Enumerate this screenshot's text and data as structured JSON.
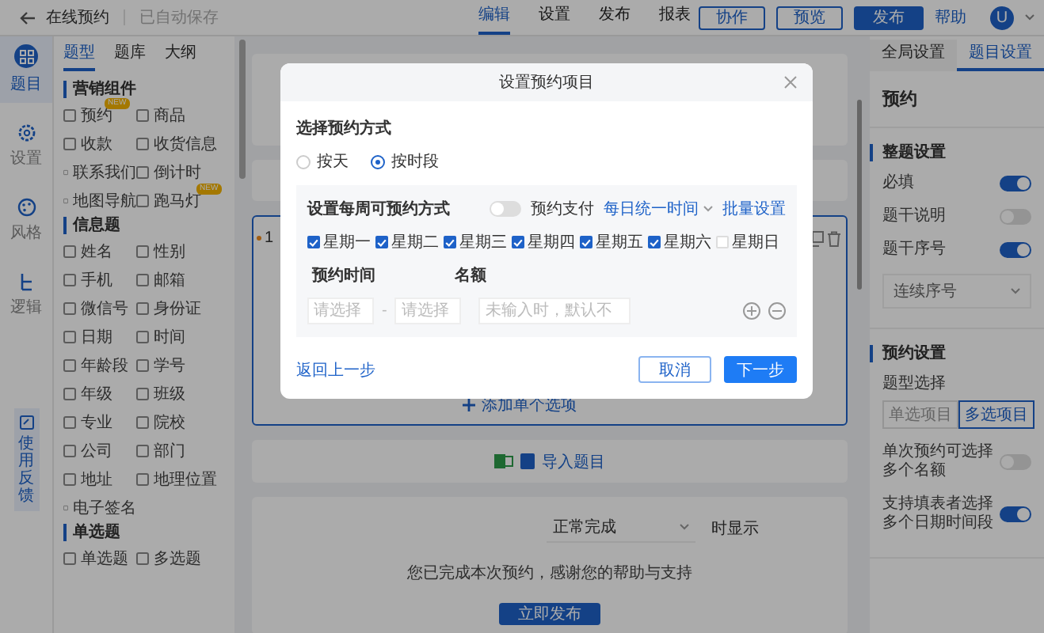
{
  "topbar": {
    "title": "在线预约",
    "save_status": "已自动保存",
    "tabs": [
      {
        "label": "编辑",
        "selected": true
      },
      {
        "label": "设置",
        "selected": false
      },
      {
        "label": "发布",
        "selected": false
      },
      {
        "label": "报表",
        "selected": false
      }
    ],
    "buttons": [
      {
        "label": "协作",
        "kind": "outline"
      },
      {
        "label": "预览",
        "kind": "outline"
      },
      {
        "label": "发布",
        "kind": "primary"
      },
      {
        "label": "帮助",
        "kind": "link"
      }
    ],
    "avatar": "U"
  },
  "rail": [
    {
      "label": "题目",
      "selected": true,
      "kind": "grid"
    },
    {
      "label": "设置",
      "selected": false,
      "kind": "gear"
    },
    {
      "label": "风格",
      "selected": false,
      "kind": "palette"
    },
    {
      "label": "逻辑",
      "selected": false,
      "kind": "flow"
    }
  ],
  "feedback": "使用反馈",
  "palette": {
    "tabs": [
      {
        "label": "题型",
        "selected": true
      },
      {
        "label": "题库",
        "selected": false
      },
      {
        "label": "大纲",
        "selected": false
      }
    ],
    "sections": [
      {
        "title": "营销组件",
        "items": [
          {
            "label": "预约",
            "badge": "NEW"
          },
          {
            "label": "商品"
          },
          {
            "label": "收款"
          },
          {
            "label": "收货信息"
          },
          {
            "label": "联系我们"
          },
          {
            "label": "倒计时"
          },
          {
            "label": "地图导航"
          },
          {
            "label": "跑马灯",
            "badge": "NEW"
          }
        ]
      },
      {
        "title": "信息题",
        "items": [
          {
            "label": "姓名"
          },
          {
            "label": "性别"
          },
          {
            "label": "手机"
          },
          {
            "label": "邮箱"
          },
          {
            "label": "微信号"
          },
          {
            "label": "身份证"
          },
          {
            "label": "日期"
          },
          {
            "label": "时间"
          },
          {
            "label": "年龄段"
          },
          {
            "label": "学号"
          },
          {
            "label": "年级"
          },
          {
            "label": "班级"
          },
          {
            "label": "专业"
          },
          {
            "label": "院校"
          },
          {
            "label": "公司"
          },
          {
            "label": "部门"
          },
          {
            "label": "地址"
          },
          {
            "label": "地理位置"
          },
          {
            "label": "电子签名"
          }
        ]
      },
      {
        "title": "单选题",
        "items": [
          {
            "label": "单选题"
          },
          {
            "label": "多选题"
          }
        ]
      }
    ]
  },
  "canvas": {
    "question_number": "1",
    "add_option": "添加单个选项",
    "import": "导入题目",
    "end": {
      "dropdown": "正常完成",
      "suffix": "时显示",
      "message": "您已完成本次预约，感谢您的帮助与支持",
      "publish": "立即发布"
    }
  },
  "settings": {
    "tabs": [
      {
        "label": "全局设置",
        "selected": false
      },
      {
        "label": "题目设置",
        "selected": true
      }
    ],
    "title": "预约",
    "sections": [
      {
        "title": "整题设置",
        "rows": [
          {
            "kind": "toggle",
            "label": "必填",
            "on": true
          },
          {
            "kind": "toggle",
            "label": "题干说明",
            "on": false
          },
          {
            "kind": "toggle",
            "label": "题干序号",
            "on": true
          },
          {
            "kind": "select",
            "value": "连续序号"
          }
        ]
      },
      {
        "title": "预约设置",
        "rows": [
          {
            "kind": "segmented",
            "label": "题型选择",
            "options": [
              {
                "label": "单选项目",
                "selected": false
              },
              {
                "label": "多选项目",
                "selected": true
              }
            ]
          },
          {
            "kind": "toggle",
            "label": "单次预约可选择多个名额",
            "on": false
          },
          {
            "kind": "toggle",
            "label": "支持填表者选择多个日期时间段",
            "on": true
          }
        ]
      }
    ]
  },
  "modal": {
    "title": "设置预约项目",
    "mode_title": "选择预约方式",
    "modes": [
      {
        "label": "按天",
        "selected": false
      },
      {
        "label": "按时段",
        "selected": true
      }
    ],
    "weekly_title": "设置每周可预约方式",
    "pay": {
      "label": "预约支付",
      "on": false
    },
    "time_mode": "每日统一时间",
    "batch": "批量设置",
    "days": [
      {
        "label": "星期一",
        "checked": true
      },
      {
        "label": "星期二",
        "checked": true
      },
      {
        "label": "星期三",
        "checked": true
      },
      {
        "label": "星期四",
        "checked": true
      },
      {
        "label": "星期五",
        "checked": true
      },
      {
        "label": "星期六",
        "checked": true
      },
      {
        "label": "星期日",
        "checked": false
      }
    ],
    "time_label": "预约时间",
    "quota_label": "名额",
    "time_inputs": [
      {
        "placeholder": "请选择"
      },
      {
        "placeholder": "请选择"
      }
    ],
    "range_separator": "-",
    "quota_placeholder": "未输入时，默认不",
    "back": "返回上一步",
    "cancel": "取消",
    "next": "下一步"
  }
}
